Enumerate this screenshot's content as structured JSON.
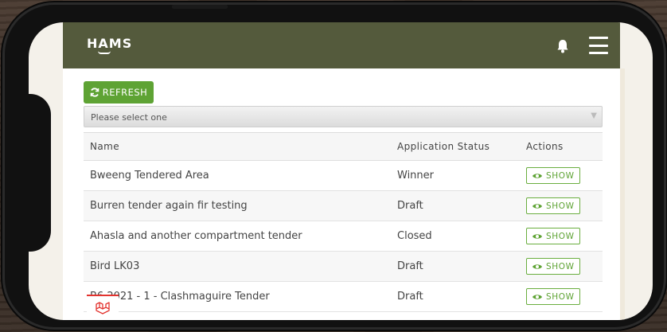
{
  "app": {
    "logo": "HAMS"
  },
  "navbar": {
    "bell_icon": "bell-icon",
    "menu_icon": "hamburger-menu-icon"
  },
  "toolbar": {
    "refresh_label": "REFRESH",
    "refresh_icon": "refresh-icon"
  },
  "filter": {
    "selected": "Please select one"
  },
  "table": {
    "columns": [
      "Name",
      "Application Status",
      "Actions"
    ],
    "rows": [
      {
        "name": "Bweeng Tendered Area",
        "status": "Winner",
        "action": "SHOW"
      },
      {
        "name": "Burren tender again fir testing",
        "status": "Draft",
        "action": "SHOW"
      },
      {
        "name": "Ahasla and another compartment tender",
        "status": "Closed",
        "action": "SHOW"
      },
      {
        "name": "Bird LK03",
        "status": "Draft",
        "action": "SHOW"
      },
      {
        "name": "B6 2021 - 1 - Clashmaguire Tender",
        "status": "Draft",
        "action": "SHOW"
      }
    ]
  },
  "colors": {
    "navbar": "#545a3c",
    "accent": "#5ea334",
    "laravel": "#e3342f"
  }
}
